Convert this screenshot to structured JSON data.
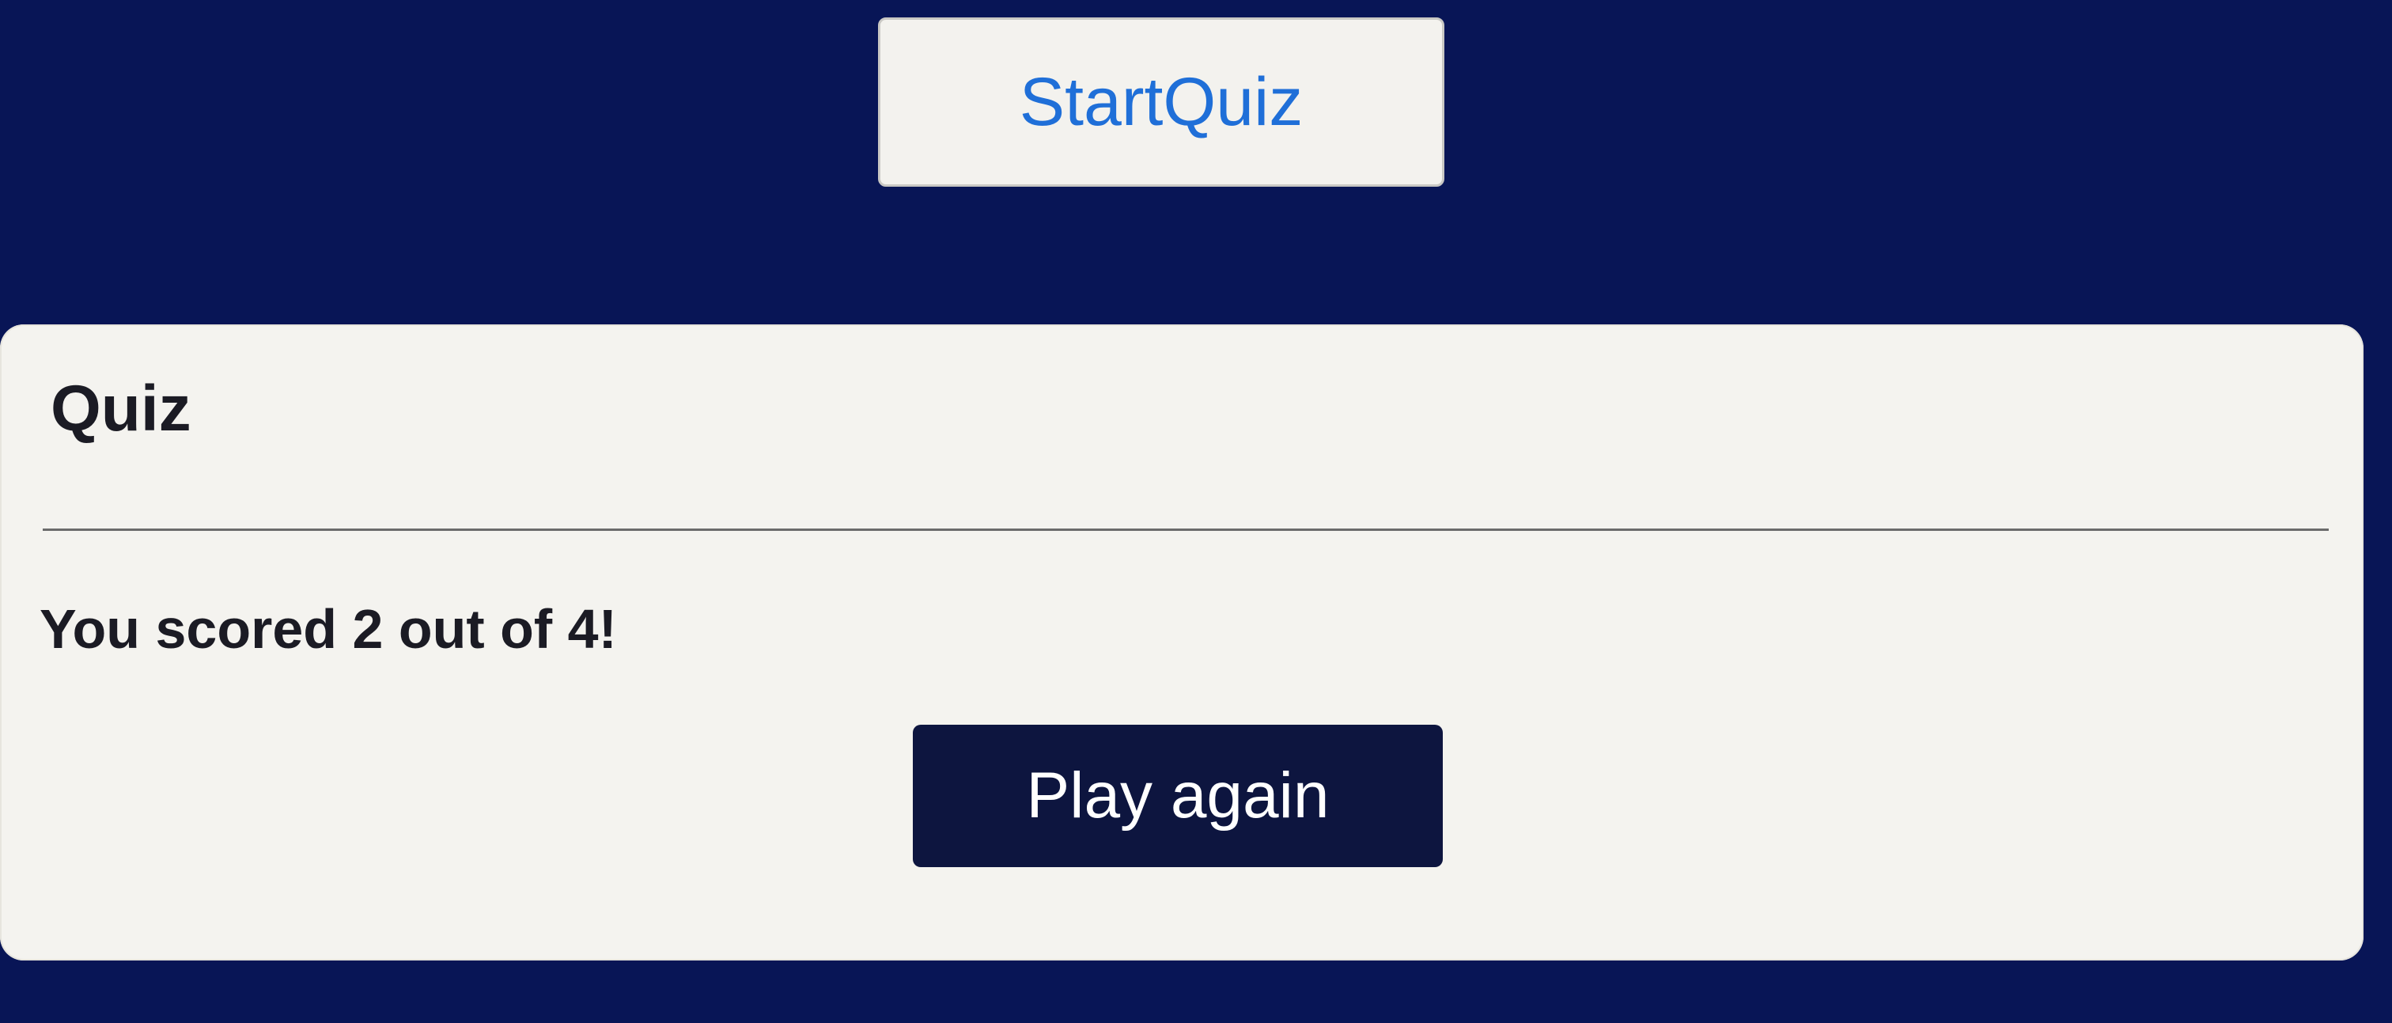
{
  "start_button": {
    "label": "StartQuiz"
  },
  "quiz": {
    "title": "Quiz",
    "result_text": "You scored 2 out of 4!",
    "play_again_label": "Play again"
  },
  "colors": {
    "background": "#081556",
    "card_background": "#f4f3ef",
    "start_label": "#1f6fd8",
    "play_button": "#0d153f",
    "text_dark": "#1b1b24"
  }
}
